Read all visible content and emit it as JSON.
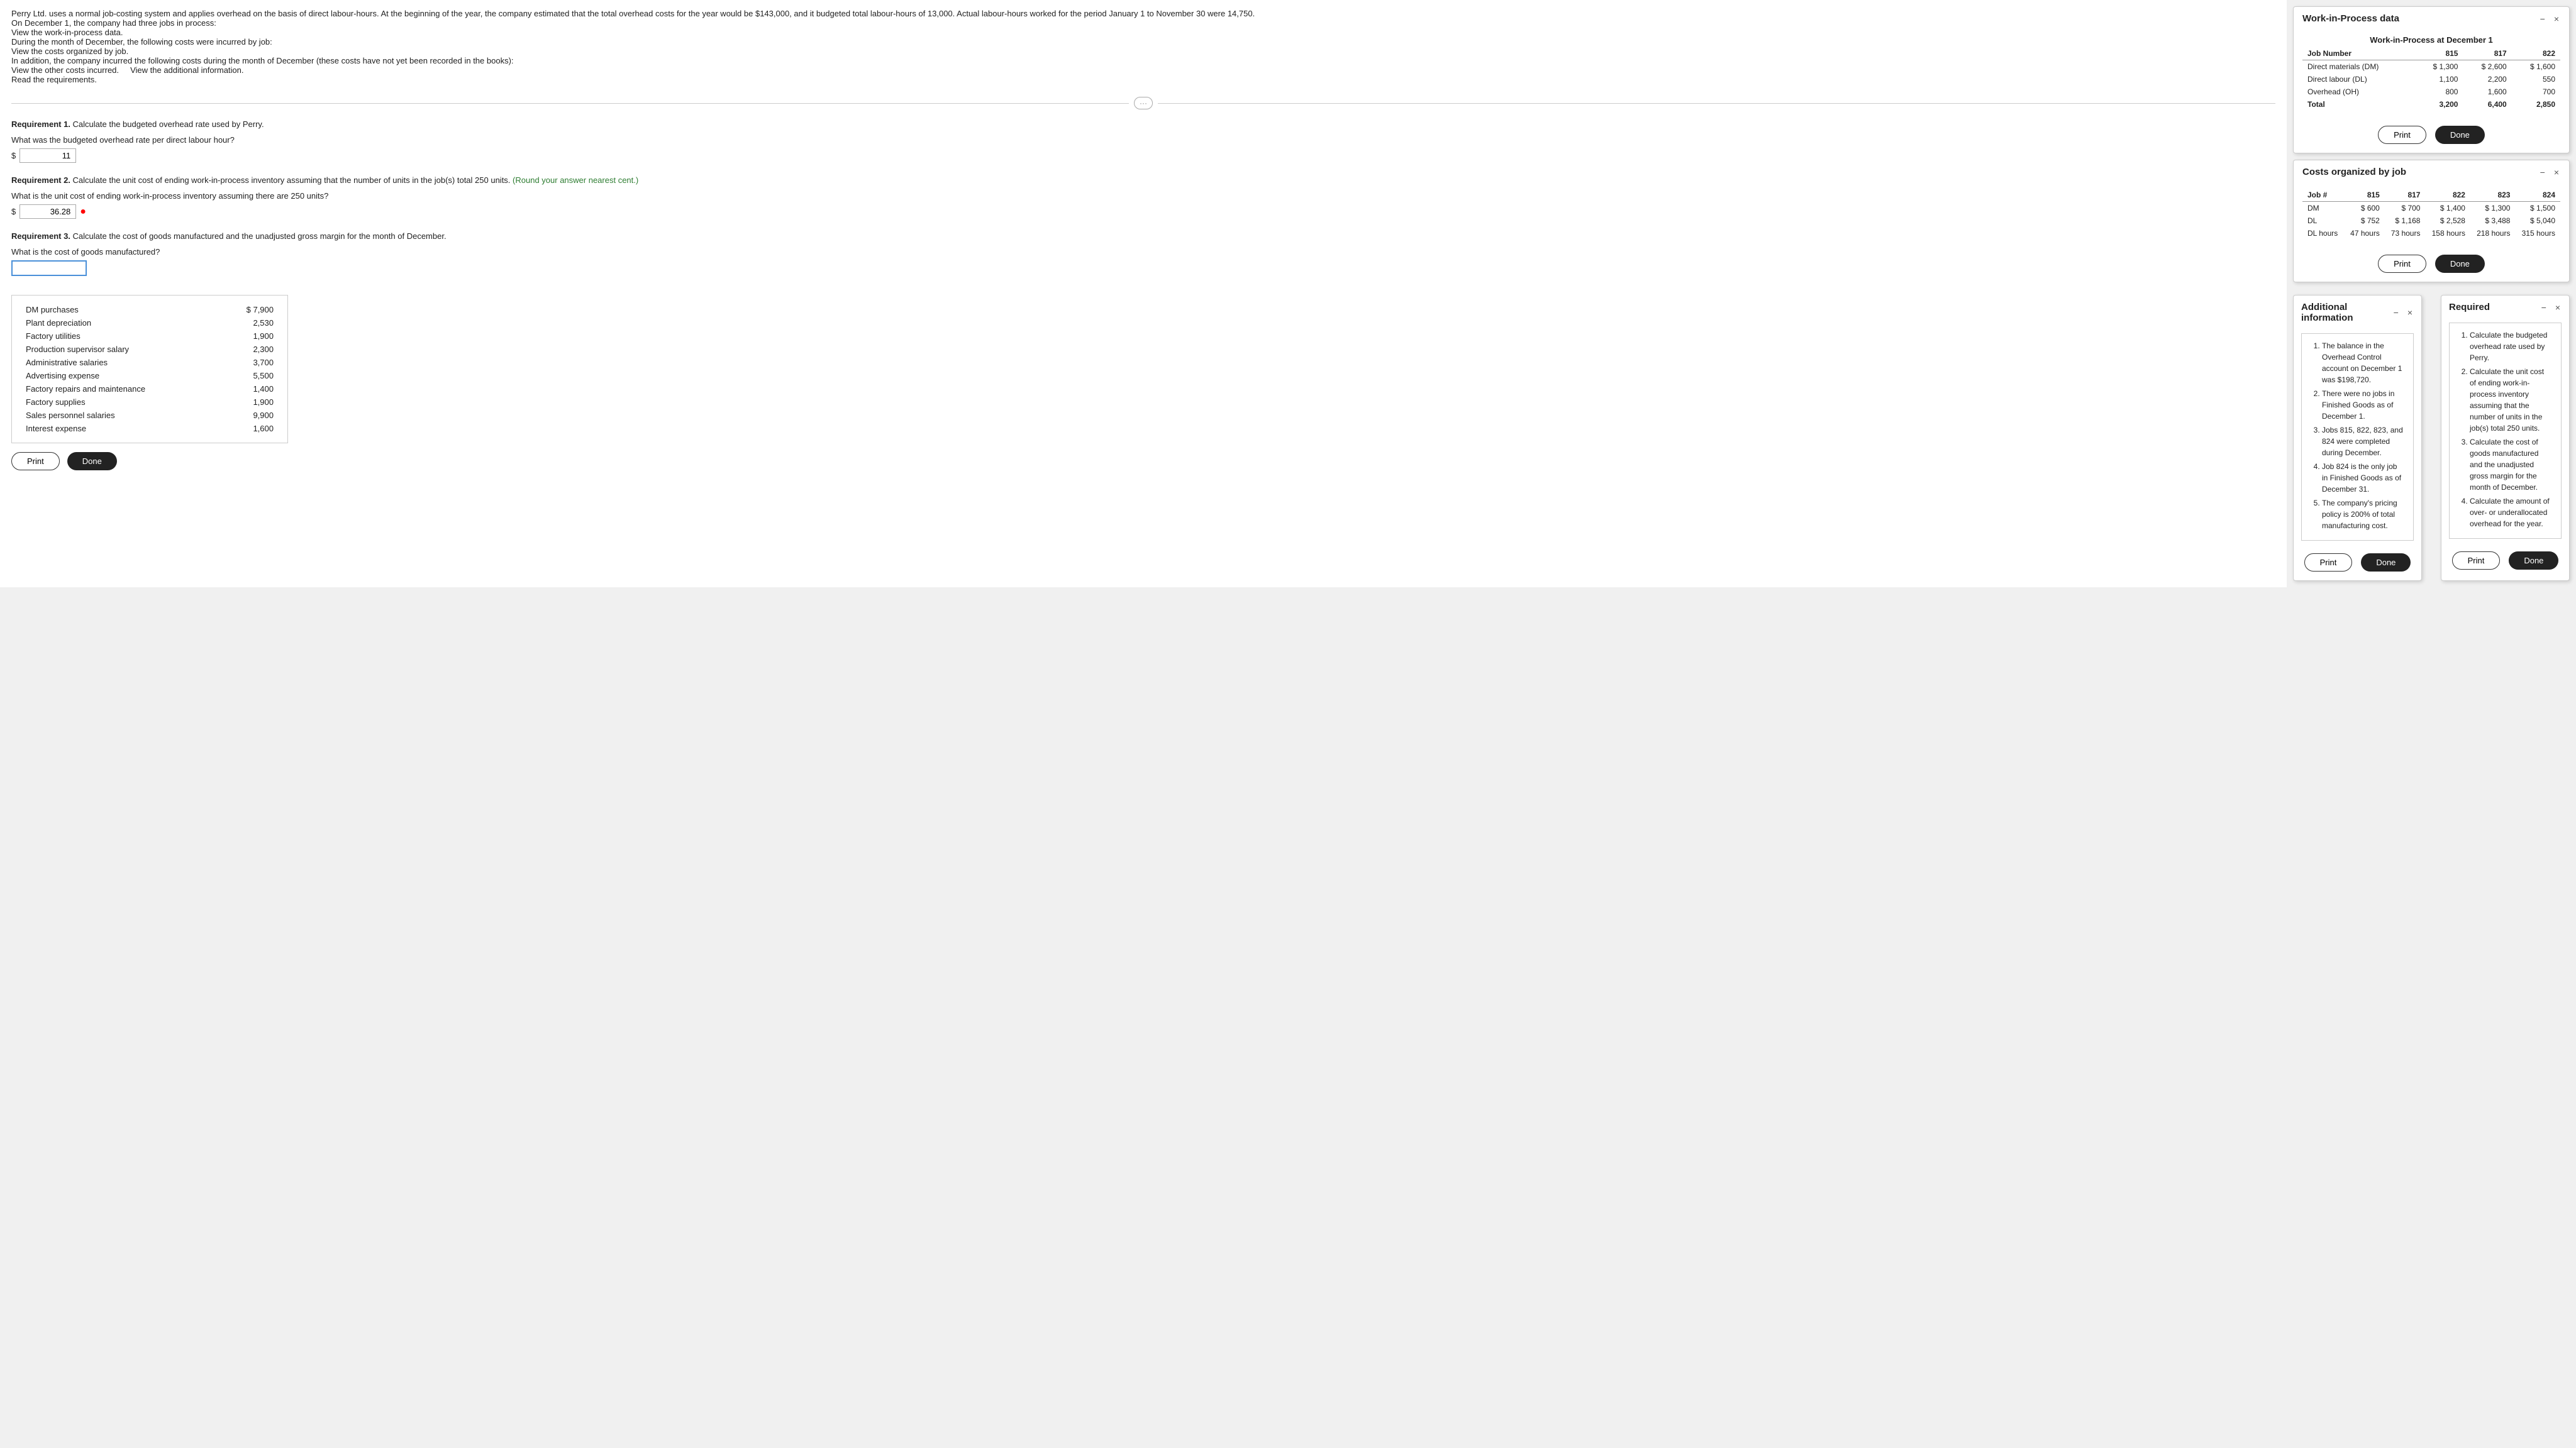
{
  "main_text": {
    "paragraph1": "Perry Ltd. uses a normal job-costing system and applies overhead on the basis of direct labour-hours. At the beginning of the year, the company estimated that the total overhead costs for the year would be $143,000, and it budgeted total labour-hours of 13,000. Actual labour-hours worked for the period January 1 to November 30 were 14,750.",
    "paragraph2": "On December 1, the company had three jobs in process:",
    "link_wip": "View the work-in-process data.",
    "paragraph3": "During the month of December, the following costs were incurred by job:",
    "link_costs": "View the costs organized by job.",
    "paragraph4": "In addition, the company incurred the following costs during the month of December (these costs have not yet been recorded in the books):",
    "link_other_costs": "View the other costs incurred.",
    "link_additional_info": "View the additional information.",
    "link_requirements": "Read the requirements."
  },
  "req1": {
    "label": "Requirement 1.",
    "text": "Calculate the budgeted overhead rate used by Perry.",
    "question": "What was the budgeted overhead rate per direct labour hour?",
    "dollar": "$",
    "value": "11"
  },
  "req2": {
    "label": "Requirement 2.",
    "text": "Calculate the unit cost of ending work-in-process inventory assuming that the number of units in the job(s) total 250 units.",
    "hint": "(Round your answer nearest cent.)",
    "question": "What is the unit cost of ending work-in-process inventory assuming there are 250 units?",
    "dollar": "$",
    "value": "36.28"
  },
  "req3": {
    "label": "Requirement 3.",
    "text": "Calculate the cost of goods manufactured and the unadjusted gross margin for the month of December.",
    "question": "What is the cost of goods manufactured?",
    "dollar": "",
    "value": ""
  },
  "divider": {
    "dots": "···"
  },
  "other_costs_table": {
    "rows": [
      {
        "label": "DM purchases",
        "value": "$ 7,900"
      },
      {
        "label": "Plant depreciation",
        "value": "2,530"
      },
      {
        "label": "Factory utilities",
        "value": "1,900"
      },
      {
        "label": "Production supervisor salary",
        "value": "2,300"
      },
      {
        "label": "Administrative salaries",
        "value": "3,700"
      },
      {
        "label": "Advertising expense",
        "value": "5,500"
      },
      {
        "label": "Factory repairs and maintenance",
        "value": "1,400"
      },
      {
        "label": "Factory supplies",
        "value": "1,900"
      },
      {
        "label": "Sales personnel salaries",
        "value": "9,900"
      },
      {
        "label": "Interest expense",
        "value": "1,600"
      }
    ]
  },
  "wip_panel": {
    "title": "Work-in-Process data",
    "caption": "Work-in-Process at December 1",
    "headers": [
      "Job Number",
      "815",
      "817",
      "822"
    ],
    "rows": [
      {
        "label": "Direct materials (DM)",
        "vals": [
          "$ 1,300",
          "$ 2,600",
          "$ 1,600"
        ]
      },
      {
        "label": "Direct labour (DL)",
        "vals": [
          "1,100",
          "2,200",
          "550"
        ]
      },
      {
        "label": "Overhead (OH)",
        "vals": [
          "800",
          "1,600",
          "700"
        ]
      },
      {
        "label": "Total",
        "vals": [
          "3,200",
          "6,400",
          "2,850"
        ]
      }
    ],
    "btn_print": "Print",
    "btn_done": "Done"
  },
  "costs_panel": {
    "title": "Costs organized by job",
    "headers": [
      "Job #",
      "815",
      "817",
      "822",
      "823",
      "824"
    ],
    "rows": [
      {
        "label": "DM",
        "vals": [
          "$ 600",
          "$ 700",
          "$ 1,400",
          "$ 1,300",
          "$ 1,500"
        ]
      },
      {
        "label": "DL",
        "vals": [
          "$ 752",
          "$ 1,168",
          "$ 2,528",
          "$ 3,488",
          "$ 5,040"
        ]
      },
      {
        "label": "DL hours",
        "vals": [
          "47 hours",
          "73 hours",
          "158 hours",
          "218 hours",
          "315 hours"
        ]
      }
    ],
    "btn_print": "Print",
    "btn_done": "Done"
  },
  "additional_panel": {
    "title": "Additional information",
    "items": [
      "The balance in the Overhead Control account on December 1 was $198,720.",
      "There were no jobs in Finished Goods as of December 1.",
      "Jobs 815, 822, 823, and 824 were completed during December.",
      "Job 824 is the only job in Finished Goods as of December 31.",
      "The company's pricing policy is 200% of total manufacturing cost."
    ],
    "btn_print": "Print",
    "btn_done": "Done"
  },
  "required_panel": {
    "title": "Required",
    "items": [
      "Calculate the budgeted overhead rate used by Perry.",
      "Calculate the unit cost of ending work-in-process inventory assuming that the number of units in the job(s) total 250 units.",
      "Calculate the cost of goods manufactured and the unadjusted gross margin for the month of December.",
      "Calculate the amount of over- or underallocated overhead for the year."
    ],
    "btn_print": "Print",
    "btn_done": "Done"
  },
  "icons": {
    "minimize": "−",
    "close": "×"
  }
}
